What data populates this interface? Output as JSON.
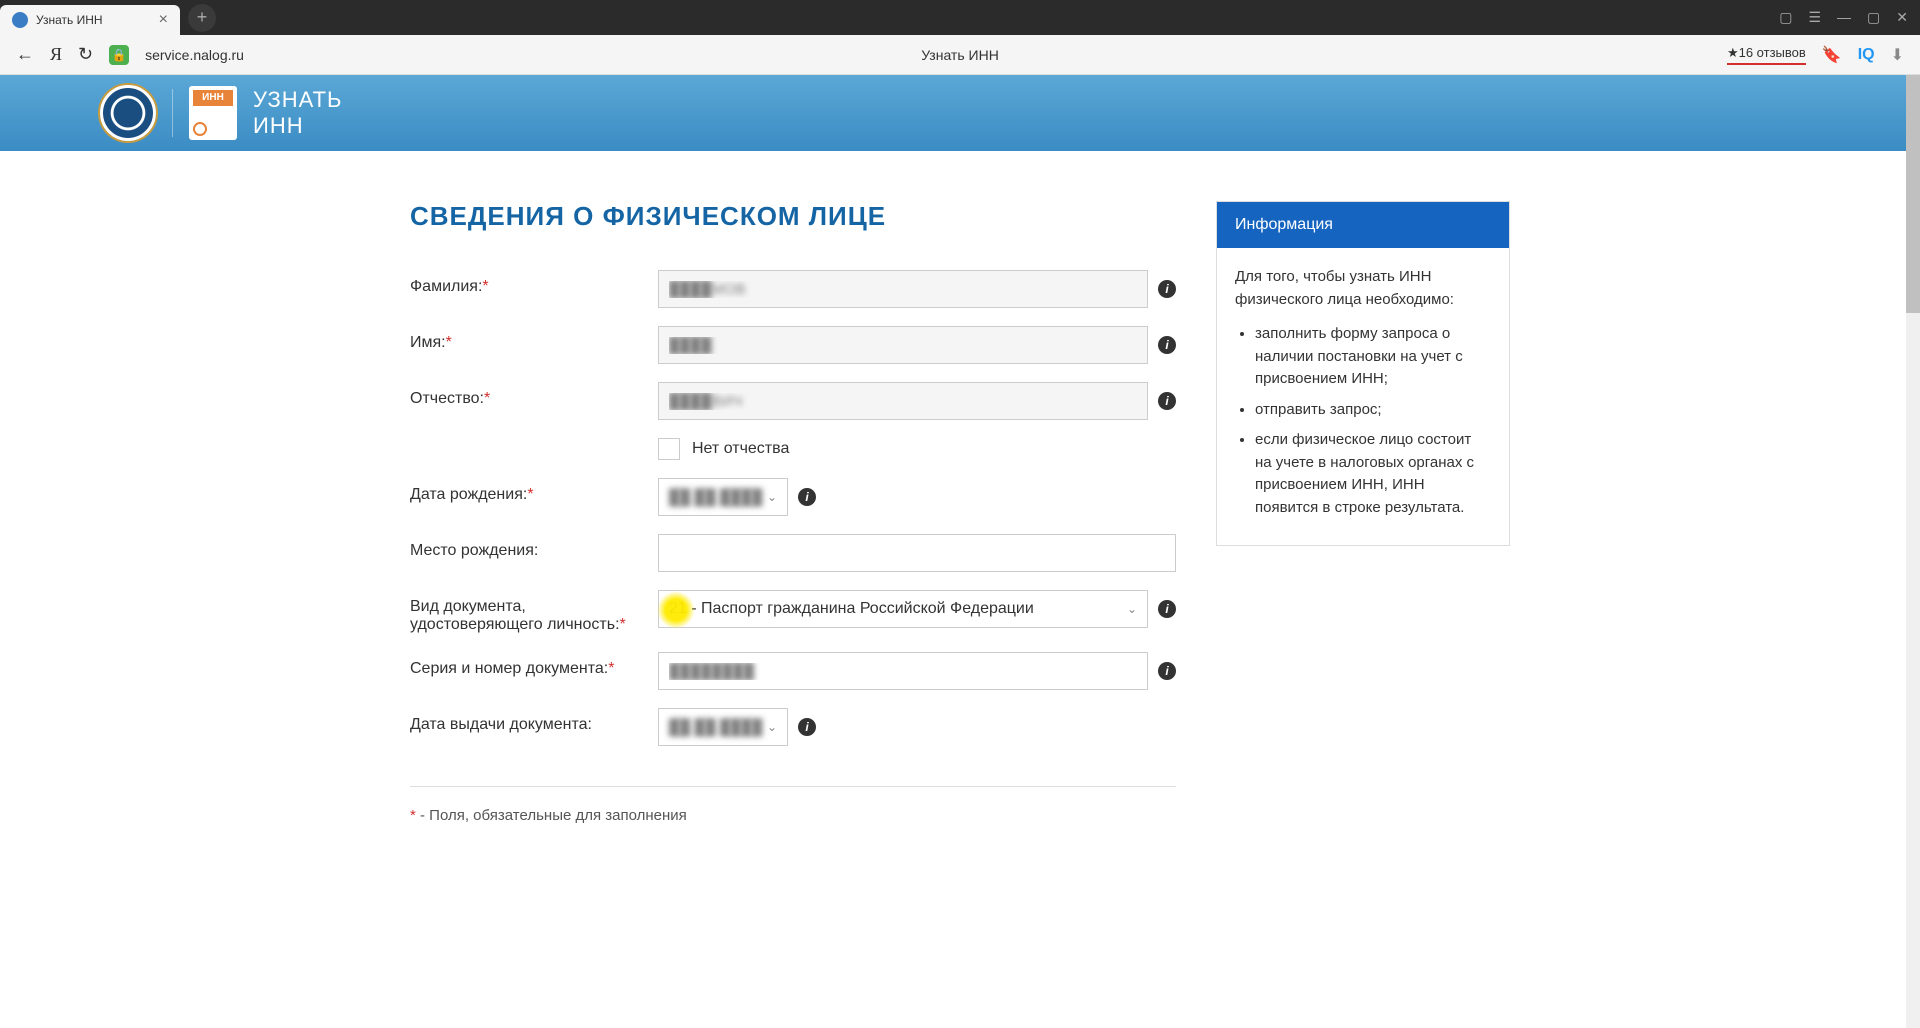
{
  "browser": {
    "tab_title": "Узнать ИНН",
    "url": "service.nalog.ru",
    "page_title_center": "Узнать ИНН",
    "reviews": "★16 отзывов"
  },
  "header": {
    "title_line1": "УЗНАТЬ",
    "title_line2": "ИНН"
  },
  "section_title": "СВЕДЕНИЯ О ФИЗИЧЕСКОМ ЛИЦЕ",
  "form": {
    "surname": {
      "label": "Фамилия:",
      "value": "████МОВ"
    },
    "name": {
      "label": "Имя:",
      "value": "████"
    },
    "patronymic": {
      "label": "Отчество:",
      "value": "████ВИЧ",
      "no_patronymic_label": "Нет отчества"
    },
    "birthdate": {
      "label": "Дата рождения:",
      "value": "██.██.████"
    },
    "birthplace": {
      "label": "Место рождения:",
      "value": ""
    },
    "doctype": {
      "label": "Вид документа, удостоверяющего личность:",
      "selected": "21 - Паспорт гражданина Российской Федерации"
    },
    "docnumber": {
      "label": "Серия и номер документа:",
      "value": "████████"
    },
    "docdate": {
      "label": "Дата выдачи документа:",
      "value": "██.██.████"
    }
  },
  "footnote": "- Поля, обязательные для заполнения",
  "info": {
    "heading": "Информация",
    "intro": "Для того, чтобы узнать ИНН физического лица необходимо:",
    "items": [
      "заполнить форму запроса о наличии постановки на учет с присвоением ИНН;",
      "отправить запрос;",
      "если физическое лицо состоит на учете в налоговых органах с присвоением ИНН, ИНН появится в строке результата."
    ]
  }
}
